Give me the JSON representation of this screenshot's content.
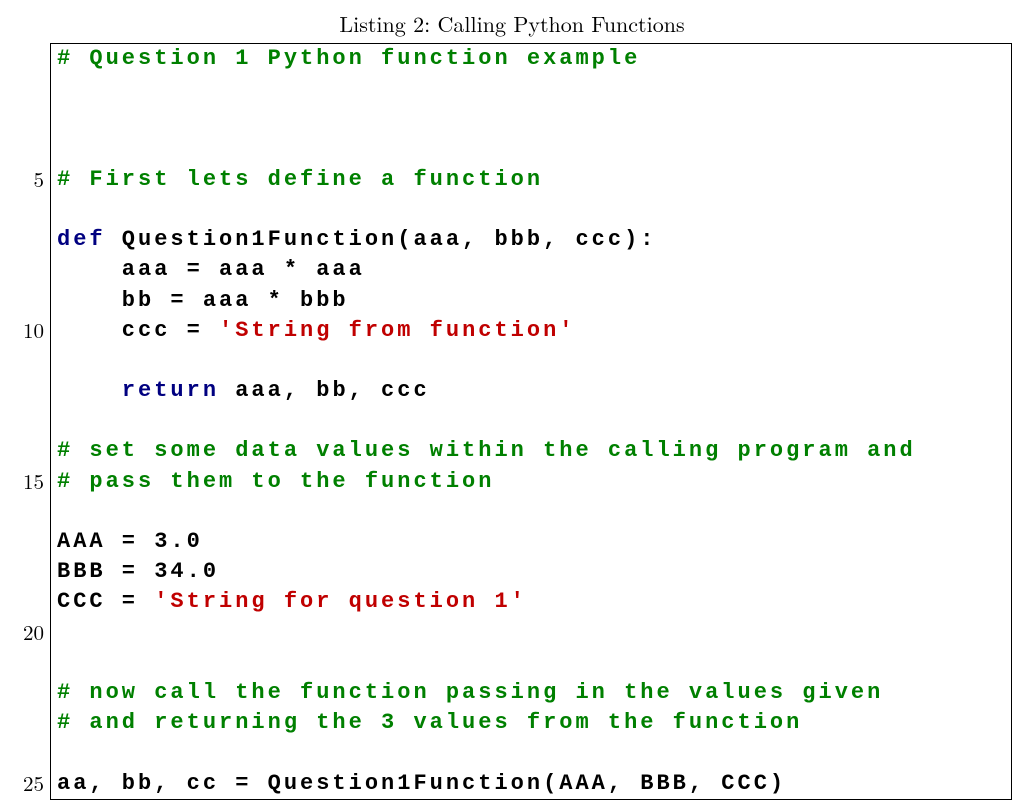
{
  "caption": "Listing 2: Calling Python Functions",
  "line_numbers": [
    "",
    "",
    "",
    "",
    "5",
    "",
    "",
    "",
    "",
    "10",
    "",
    "",
    "",
    "",
    "15",
    "",
    "",
    "",
    "",
    "20",
    "",
    "",
    "",
    "",
    "25"
  ],
  "code": {
    "l1_comment": "# Question 1 Python function example",
    "l5_comment": "# First lets define a function",
    "l7_def": "def",
    "l7_rest": " Question1Function(aaa, bbb, ccc):",
    "l8": "    aaa = aaa * aaa",
    "l9": "    bb = aaa * bbb",
    "l10_pre": "    ccc = ",
    "l10_str": "'String from function'",
    "l12_pre": "    ",
    "l12_ret": "return",
    "l12_rest": " aaa, bb, ccc",
    "l14_comment": "# set some data values within the calling program and",
    "l15_comment": "# pass them to the function",
    "l17": "AAA = 3.0",
    "l18": "BBB = 34.0",
    "l19_pre": "CCC = ",
    "l19_str": "'String for question 1'",
    "l22_comment": "# now call the function passing in the values given",
    "l23_comment": "# and returning the 3 values from the function",
    "l25": "aa, bb, cc = Question1Function(AAA, BBB, CCC)"
  }
}
